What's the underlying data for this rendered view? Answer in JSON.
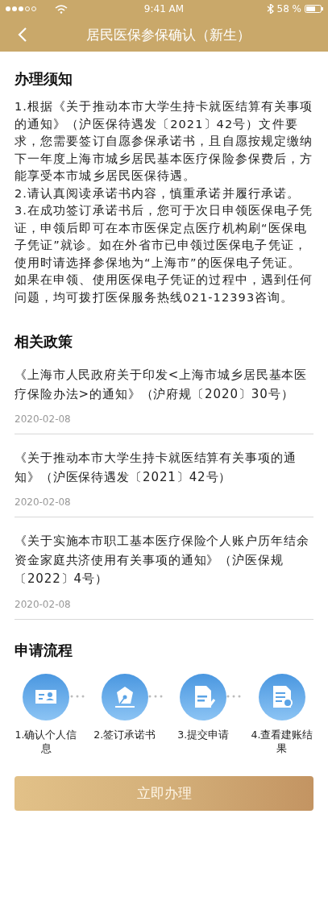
{
  "status_bar": {
    "time": "9:41 AM",
    "battery": "58 %"
  },
  "nav_bar": {
    "title": "居民医保参保确认（新生）"
  },
  "notice": {
    "heading": "办理须知",
    "paragraphs": [
      "1.根据《关于推动本市大学生持卡就医结算有关事项的通知》（沪医保待遇发〔2021〕42号）文件要求，您需要签订自愿参保承诺书，且自愿按规定缴纳下一年度上海市城乡居民基本医疗保险参保费后，方能享受本市城乡居民医保待遇。",
      "2.请认真阅读承诺书内容，慎重承诺并履行承诺。",
      "3.在成功签订承诺书后，您可于次日申领医保电子凭证，申领后即可在本市医保定点医疗机构刷“医保电子凭证”就诊。如在外省市已申领过医保电子凭证，使用时请选择参保地为“上海市”的医保电子凭证。如果在申领、使用医保电子凭证的过程中，遇到任何问题，均可拨打医保服务热线021-12393咨询。"
    ]
  },
  "policies": {
    "heading": "相关政策",
    "items": [
      {
        "title": "《上海市人民政府关于印发<上海市城乡居民基本医疗保险办法>的通知》（沪府规〔2020〕30号）",
        "date": "2020-02-08"
      },
      {
        "title": "《关于推动本市大学生持卡就医结算有关事项的通知》（沪医保待遇发〔2021〕42号）",
        "date": "2020-02-08"
      },
      {
        "title": "《关于实施本市职工基本医疗保险个人账户历年结余资金家庭共济使用有关事项的通知》（沪医保规〔2022〕4号）",
        "date": "2020-02-08"
      }
    ]
  },
  "process": {
    "heading": "申请流程",
    "steps": [
      "1.确认个人信息",
      "2.签订承诺书",
      "3.提交申请",
      "4.查看建账结果"
    ]
  },
  "action_button": "立即办理"
}
